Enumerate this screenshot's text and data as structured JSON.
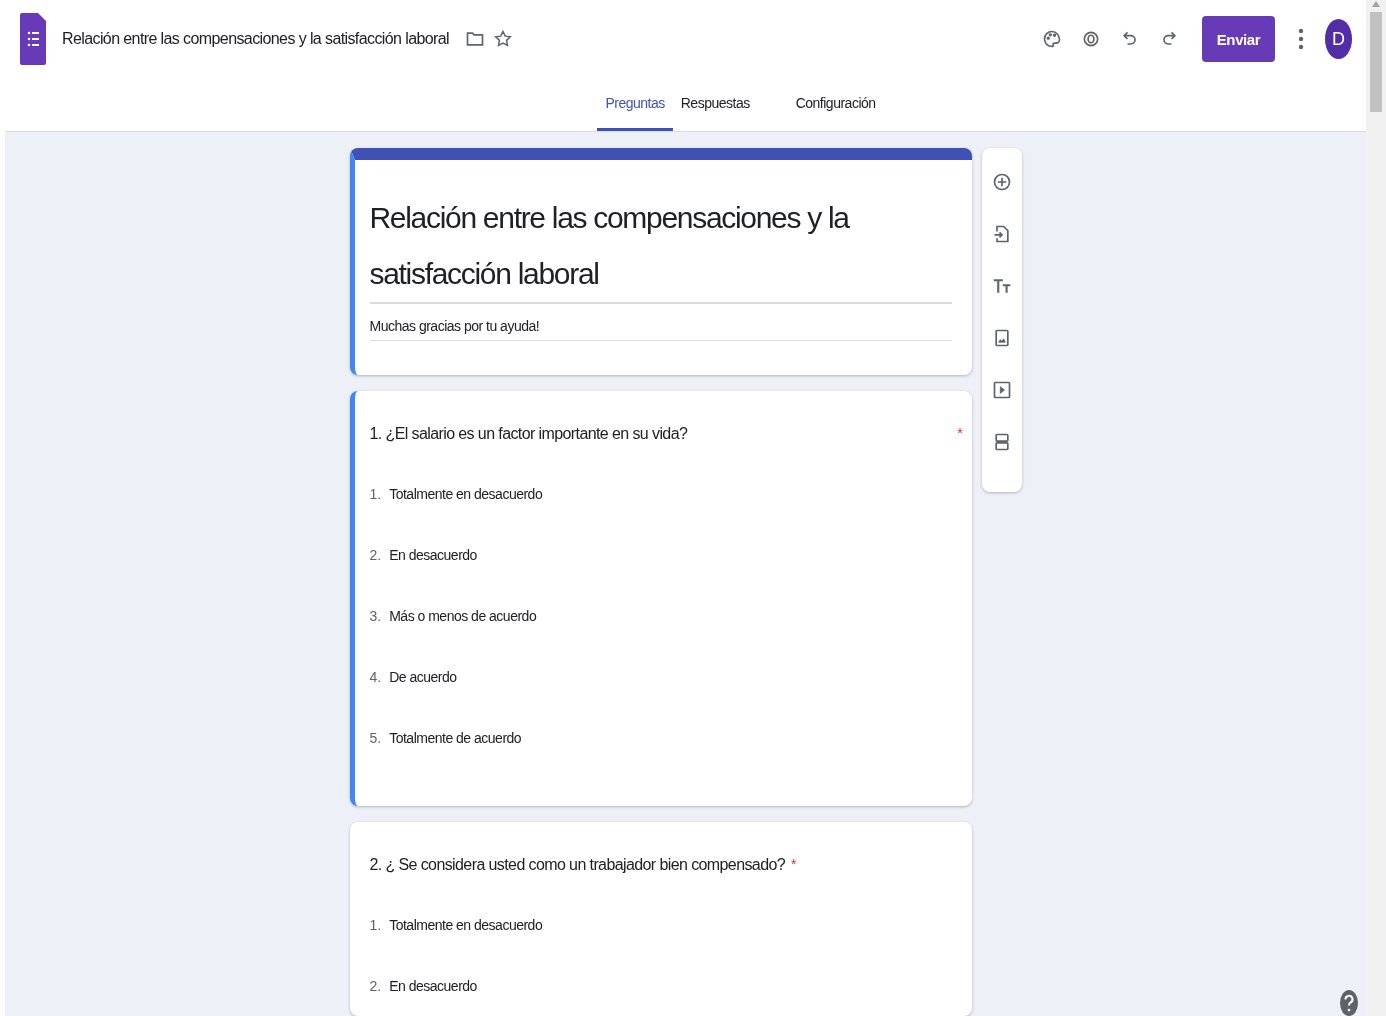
{
  "header": {
    "title": "Relación entre las compensaciones y la satisfacción laboral",
    "send_button": "Enviar",
    "avatar": "D"
  },
  "tabs": [
    {
      "label": "Preguntas",
      "selected": true
    },
    {
      "label": "Respuestas",
      "selected": false
    },
    {
      "label": "Configuración",
      "selected": false
    }
  ],
  "form": {
    "title": "Relación entre las compensaciones y la satisfacción laboral",
    "description": "Muchas gracias por tu ayuda!",
    "active": true
  },
  "questions": [
    {
      "title": "1. ¿El salario es un factor importante en su vida?",
      "required_mark": "*",
      "active": true,
      "options": [
        {
          "number": "1.",
          "label": "Totalmente en desacuerdo"
        },
        {
          "number": "2.",
          "label": "En desacuerdo"
        },
        {
          "number": "3.",
          "label": "Más o menos de acuerdo"
        },
        {
          "number": "4.",
          "label": "De acuerdo"
        },
        {
          "number": "5.",
          "label": "Totalmente de acuerdo"
        }
      ]
    },
    {
      "title": "2. ¿ Se considera usted como un trabajador bien compensado?",
      "required_mark": "*",
      "active": false,
      "options": [
        {
          "number": "1.",
          "label": "Totalmente en desacuerdo"
        },
        {
          "number": "2.",
          "label": "En desacuerdo"
        }
      ]
    }
  ]
}
